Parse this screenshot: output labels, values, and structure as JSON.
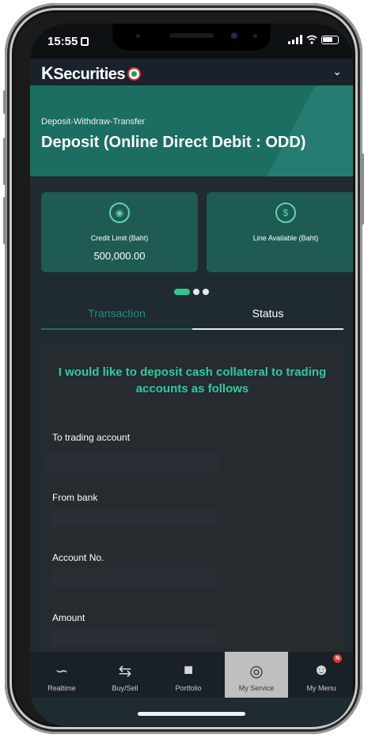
{
  "status_bar": {
    "time": "15:55"
  },
  "app": {
    "logo_text": "Securities",
    "logo_k": "K"
  },
  "banner": {
    "breadcrumb": "Deposit-Withdraw-Transfer",
    "title": "Deposit (Online Direct Debit : ODD)"
  },
  "cards": [
    {
      "label": "Credit Limit (Baht)",
      "value": "500,000.00",
      "icon": "money-icon"
    },
    {
      "label": "Line Available (Baht)",
      "value": "",
      "icon": "hand-coin-icon"
    }
  ],
  "carousel": {
    "pages": 3,
    "active_index": 0
  },
  "tabs": [
    {
      "label": "Transaction",
      "active": true
    },
    {
      "label": "Status",
      "active": false
    }
  ],
  "form": {
    "intro": "I would like to deposit cash collateral to trading accounts as follows",
    "fields": [
      {
        "label": "To trading account",
        "value": ""
      },
      {
        "label": "From bank",
        "value": ""
      },
      {
        "label": "Account No.",
        "value": ""
      },
      {
        "label": "Amount",
        "value": ""
      }
    ]
  },
  "bottom_nav": [
    {
      "label": "Realtime",
      "icon": "chart-icon",
      "selected": false
    },
    {
      "label": "Buy/Sell",
      "icon": "arrows-icon",
      "selected": false
    },
    {
      "label": "Portfolio",
      "icon": "folder-icon",
      "selected": false
    },
    {
      "label": "My Service",
      "icon": "service-icon",
      "selected": true
    },
    {
      "label": "My Menu",
      "icon": "user-menu-icon",
      "selected": false,
      "badge": "N"
    }
  ],
  "colors": {
    "accent": "#2fc98b",
    "banner": "#1c6e62",
    "card": "#1e5b52",
    "background": "#1f2b31"
  }
}
